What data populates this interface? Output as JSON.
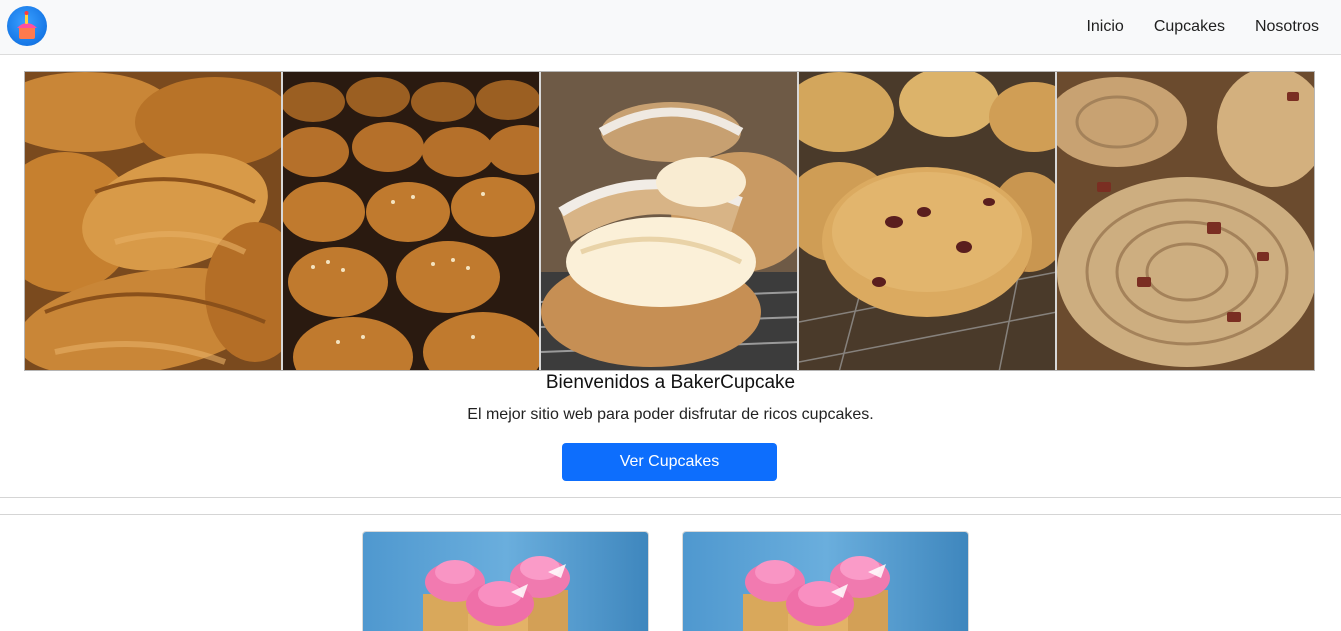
{
  "brand": {
    "logo_icon": "cupcake-logo-icon"
  },
  "nav": {
    "items": [
      "Inicio",
      "Cupcakes",
      "Nosotros"
    ]
  },
  "gallery": {
    "photos": [
      "croissants",
      "sesame-buns",
      "cream-puffs",
      "muffins",
      "pinwheel-pastries"
    ]
  },
  "hero": {
    "title": "Bienvenidos a BakerCupcake",
    "subtitle": "El mejor sitio web para poder disfrutar de ricos cupcakes.",
    "button_label": "Ver Cupcakes"
  },
  "cards": [
    {
      "image": "pink-cupcakes"
    },
    {
      "image": "pink-cupcakes"
    }
  ],
  "colors": {
    "primary": "#0d6efd",
    "navbar_bg": "#f8f9fa",
    "card_bg": "#3f8bc2"
  }
}
